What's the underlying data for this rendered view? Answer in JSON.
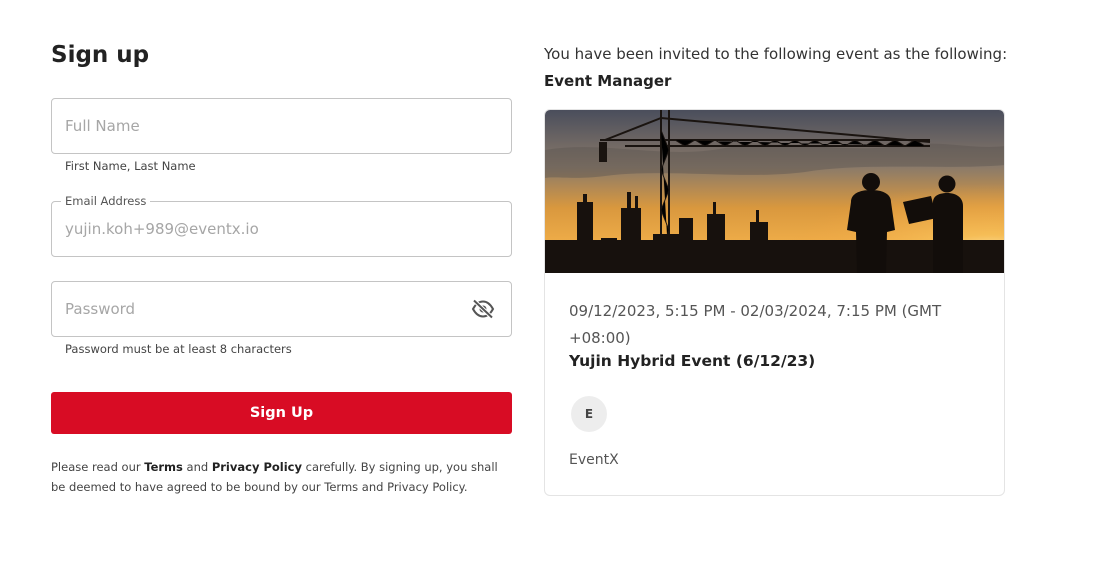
{
  "signup": {
    "title": "Sign up",
    "full_name": {
      "placeholder": "Full Name",
      "helper": "First Name, Last Name"
    },
    "email": {
      "label": "Email Address",
      "value": "yujin.koh+989@eventx.io"
    },
    "password": {
      "placeholder": "Password",
      "helper": "Password must be at least 8 characters",
      "icon": "eye-off-icon"
    },
    "button_label": "Sign Up",
    "legal": {
      "prefix": "Please read our ",
      "terms": "Terms",
      "and": " and ",
      "privacy": "Privacy Policy",
      "suffix": " carefully. By signing up, you shall be deemed to have agreed to be bound by our Terms and Privacy Policy."
    },
    "accent_color": "#d80c24"
  },
  "invitation": {
    "text": "You have been invited to the following event as the following:",
    "role": "Event Manager",
    "event": {
      "date": "09/12/2023, 5:15 PM - 02/03/2024, 7:15 PM (GMT +08:00)",
      "name": "Yujin Hybrid Event (6/12/23)",
      "organizer_initial": "E",
      "organizer_name": "EventX"
    }
  }
}
